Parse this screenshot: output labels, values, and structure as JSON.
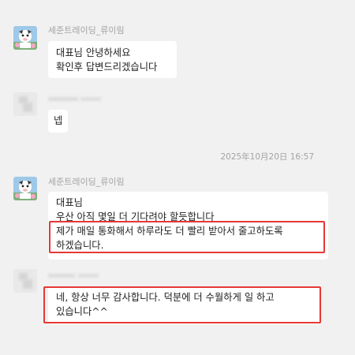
{
  "conversation": {
    "messages": [
      {
        "sender": "세준트레이딩_류이림",
        "lines": [
          "대표님 안녕하세요",
          "확인후 답변드리겠습니다"
        ]
      },
      {
        "sender": "",
        "lines": [
          "넵"
        ]
      },
      {
        "sender": "세준트레이딩_류이림",
        "lines": [
          "대표님",
          "우산 아직 몇일 더 기다려야 할듯합니다"
        ],
        "highlighted": "제가 매일 통화해서 하루라도 더 빨리 받아서 줄고하도록 하겠습니다."
      },
      {
        "sender": "",
        "highlighted": "네, 항상 너무 감사합니다. 덕분에 더 수월하게 일 하고 있습니다^^"
      }
    ],
    "timestamp": "2025年10月20日 16:57"
  },
  "colors": {
    "background": "#f1f1f1",
    "bubble": "#ffffff",
    "highlight_border": "#e53935",
    "meta_text": "#a3a3a3"
  }
}
